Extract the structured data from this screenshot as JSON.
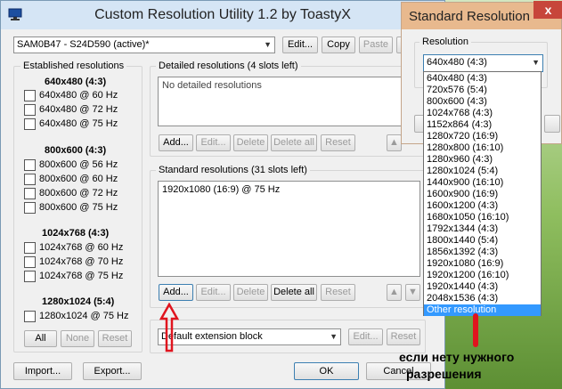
{
  "window": {
    "title": "Custom Resolution Utility 1.2 by ToastyX",
    "monitor_value": "SAM0B47 - S24D590 (active)*",
    "edit_label": "Edit...",
    "copy_label": "Copy",
    "paste_label": "Paste"
  },
  "established": {
    "title": "Established resolutions",
    "groups": [
      {
        "heading": "640x480 (4:3)",
        "items": [
          "640x480 @ 60 Hz",
          "640x480 @ 72 Hz",
          "640x480 @ 75 Hz"
        ]
      },
      {
        "heading": "800x600 (4:3)",
        "items": [
          "800x600 @ 56 Hz",
          "800x600 @ 60 Hz",
          "800x600 @ 72 Hz",
          "800x600 @ 75 Hz"
        ]
      },
      {
        "heading": "1024x768 (4:3)",
        "items": [
          "1024x768 @ 60 Hz",
          "1024x768 @ 70 Hz",
          "1024x768 @ 75 Hz"
        ]
      },
      {
        "heading": "1280x1024 (5:4)",
        "items": [
          "1280x1024 @ 75 Hz"
        ]
      }
    ],
    "all_label": "All",
    "none_label": "None",
    "reset_label": "Reset"
  },
  "detailed": {
    "title": "Detailed resolutions (4 slots left)",
    "empty_text": "No detailed resolutions",
    "add_label": "Add...",
    "edit_label": "Edit...",
    "delete_label": "Delete",
    "delete_all_label": "Delete all",
    "reset_label": "Reset"
  },
  "standard": {
    "title": "Standard resolutions (31 slots left)",
    "items": [
      "1920x1080 (16:9) @ 75 Hz"
    ],
    "add_label": "Add...",
    "edit_label": "Edit...",
    "delete_label": "Delete",
    "delete_all_label": "Delete all",
    "reset_label": "Reset"
  },
  "extension": {
    "value": "Default extension block",
    "edit_label": "Edit...",
    "reset_label": "Reset"
  },
  "footer": {
    "import_label": "Import...",
    "export_label": "Export...",
    "ok_label": "OK",
    "cancel_label": "Cancel"
  },
  "standard_dialog": {
    "title": "Standard Resolution",
    "close_glyph": "x",
    "resolution_label": "Resolution",
    "selected": "640x480 (4:3)",
    "options": [
      "640x480 (4:3)",
      "720x576 (5:4)",
      "800x600 (4:3)",
      "1024x768 (4:3)",
      "1152x864 (4:3)",
      "1280x720 (16:9)",
      "1280x800 (16:10)",
      "1280x960 (4:3)",
      "1280x1024 (5:4)",
      "1440x900 (16:10)",
      "1600x900 (16:9)",
      "1600x1200 (4:3)",
      "1680x1050 (16:10)",
      "1792x1344 (4:3)",
      "1800x1440 (5:4)",
      "1856x1392 (4:3)",
      "1920x1080 (16:9)",
      "1920x1200 (16:10)",
      "1920x1440 (4:3)",
      "2048x1536 (4:3)",
      "Other resolution"
    ],
    "highlighted_index": 20
  },
  "annotation": {
    "line1": "если нету нужного",
    "line2": "разрешения"
  },
  "colors": {
    "accent_red": "#e0141e",
    "highlight": "#3399ff"
  }
}
